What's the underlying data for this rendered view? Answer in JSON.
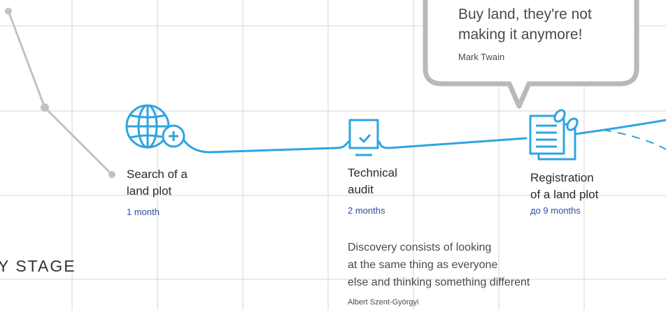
{
  "colors": {
    "accent": "#2ea4e0",
    "grid": "#d4d4d4",
    "connector": "#bdbdbd",
    "duration": "#2b4f9e",
    "bubble_border": "#b9b9b9"
  },
  "bubble": {
    "quote_lines": [
      "Buy land, they're not",
      "making it anymore!"
    ],
    "author": "Mark Twain"
  },
  "steps": [
    {
      "title_lines": [
        "Search of a",
        "land plot"
      ],
      "duration": "1 month",
      "icon": "globe-search-icon"
    },
    {
      "title_lines": [
        "Technical",
        "audit"
      ],
      "duration": "2 months",
      "icon": "audit-document-icon"
    },
    {
      "title_lines": [
        "Registration",
        "of a land plot"
      ],
      "duration": "до 9 months",
      "icon": "registration-documents-icon"
    }
  ],
  "stage_label": "Y STAGE",
  "quote2": {
    "lines": [
      "Discovery consists of looking",
      "at the same thing as everyone",
      "else and thinking something different"
    ],
    "author": "Albert Szent-Györgyi"
  }
}
